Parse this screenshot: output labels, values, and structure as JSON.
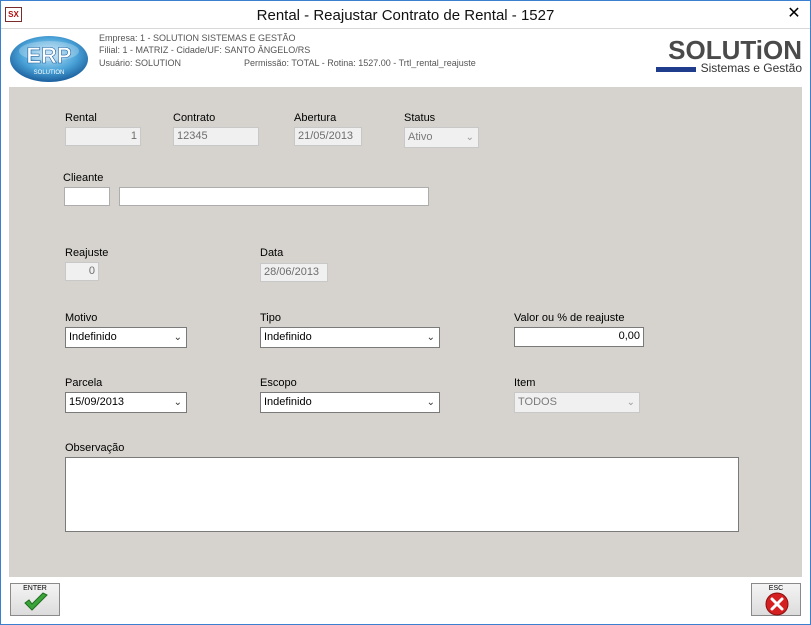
{
  "window": {
    "title": "Rental - Reajustar Contrato de Rental - 1527"
  },
  "header": {
    "erp_logo_text": "ERP",
    "erp_logo_sub": "SOLUTION",
    "empresa": "Empresa: 1 - SOLUTION SISTEMAS E GESTÃO",
    "filial": "Filial: 1 - MATRIZ - Cidade/UF: SANTO ÂNGELO/RS",
    "usuario": "Usuário: SOLUTION",
    "permissao": "Permissão: TOTAL - Rotina: 1527.00 - Trtl_rental_reajuste",
    "brand_main": "SOLUTiON",
    "brand_sub": "Sistemas e Gestão"
  },
  "form": {
    "rental": {
      "label": "Rental",
      "value": "1"
    },
    "contrato": {
      "label": "Contrato",
      "value": "12345"
    },
    "abertura": {
      "label": "Abertura",
      "value": "21/05/2013"
    },
    "status": {
      "label": "Status",
      "value": "Ativo"
    },
    "cliente": {
      "label": "Clieante",
      "code": "",
      "name": ""
    },
    "reajuste": {
      "label": "Reajuste",
      "value": "0"
    },
    "data": {
      "label": "Data",
      "value": "28/06/2013"
    },
    "motivo": {
      "label": "Motivo",
      "value": "Indefinido"
    },
    "tipo": {
      "label": "Tipo",
      "value": "Indefinido"
    },
    "valor": {
      "label": "Valor ou % de reajuste",
      "value": "0,00"
    },
    "parcela": {
      "label": "Parcela",
      "value": "15/09/2013"
    },
    "escopo": {
      "label": "Escopo",
      "value": "Indefinido"
    },
    "item": {
      "label": "Item",
      "value": "TODOS"
    },
    "observacao": {
      "label": "Observação",
      "value": ""
    }
  },
  "footer": {
    "enter_label": "ENTER",
    "esc_label": "ESC"
  },
  "colors": {
    "form_bg": "#d6d3ce",
    "brand_blue": "#1f3d8c",
    "confirm_green": "#3aa43a",
    "cancel_red": "#d42020"
  }
}
